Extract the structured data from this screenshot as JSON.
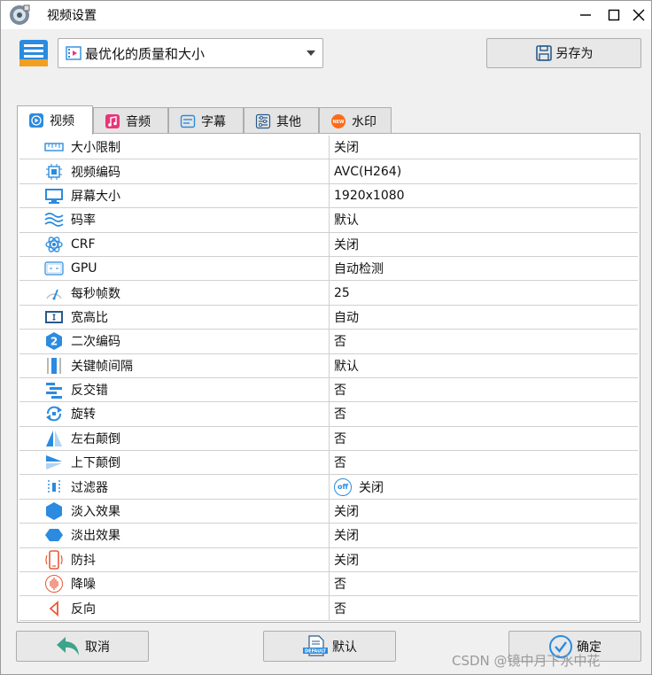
{
  "window": {
    "title": "视频设置"
  },
  "preset": {
    "selected": "最优化的质量和大小"
  },
  "toolbar": {
    "save_as_label": "另存为"
  },
  "tabs": [
    {
      "label": "视频",
      "icon": "play-icon",
      "active": true
    },
    {
      "label": "音频",
      "icon": "music-icon",
      "active": false
    },
    {
      "label": "字幕",
      "icon": "subtitle-icon",
      "active": false
    },
    {
      "label": "其他",
      "icon": "sliders-icon",
      "active": false
    },
    {
      "label": "水印",
      "icon": "new-badge-icon",
      "active": false
    }
  ],
  "settings": [
    {
      "label": "大小限制",
      "value": "关闭",
      "icon": "ruler-icon"
    },
    {
      "label": "视频编码",
      "value": "AVC(H264)",
      "icon": "chip-icon"
    },
    {
      "label": "屏幕大小",
      "value": "1920x1080",
      "icon": "monitor-icon"
    },
    {
      "label": "码率",
      "value": "默认",
      "icon": "wave-icon"
    },
    {
      "label": "CRF",
      "value": "关闭",
      "icon": "atom-icon"
    },
    {
      "label": "GPU",
      "value": "自动检测",
      "icon": "gpu-icon"
    },
    {
      "label": "每秒帧数",
      "value": "25",
      "icon": "fps-icon"
    },
    {
      "label": "宽高比",
      "value": "自动",
      "icon": "aspect-icon"
    },
    {
      "label": "二次编码",
      "value": "否",
      "icon": "two-pass-icon"
    },
    {
      "label": "关键帧间隔",
      "value": "默认",
      "icon": "keyframe-icon"
    },
    {
      "label": "反交错",
      "value": "否",
      "icon": "deinterlace-icon"
    },
    {
      "label": "旋转",
      "value": "否",
      "icon": "rotate-icon"
    },
    {
      "label": "左右颠倒",
      "value": "否",
      "icon": "flip-horizontal-icon"
    },
    {
      "label": "上下颠倒",
      "value": "否",
      "icon": "flip-vertical-icon"
    },
    {
      "label": "过滤器",
      "value": "关闭",
      "icon": "filter-icon",
      "badge": "off"
    },
    {
      "label": "淡入效果",
      "value": "关闭",
      "icon": "fade-in-icon"
    },
    {
      "label": "淡出效果",
      "value": "关闭",
      "icon": "fade-out-icon"
    },
    {
      "label": "防抖",
      "value": "关闭",
      "icon": "stabilize-icon"
    },
    {
      "label": "降噪",
      "value": "否",
      "icon": "denoise-icon"
    },
    {
      "label": "反向",
      "value": "否",
      "icon": "reverse-icon"
    }
  ],
  "footer": {
    "cancel_label": "取消",
    "default_label": "默认",
    "default_icon_text": "DEFAULT",
    "ok_label": "确定"
  },
  "watermark": "CSDN @镜中月下水中花",
  "colors": {
    "accent_blue": "#2a8be0",
    "cancel_green": "#3aa58a",
    "music_pink": "#e8357a",
    "badge_orange": "#ff6a1a"
  }
}
